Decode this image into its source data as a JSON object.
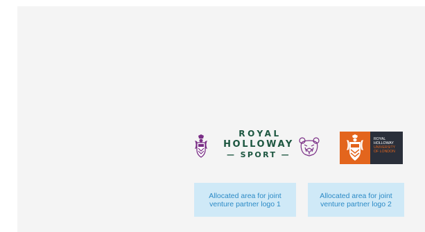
{
  "logos": {
    "sport": {
      "line1": "ROYAL",
      "line2": "HOLLOWAY",
      "line3": "— SPORT —",
      "color": "#1d5640",
      "accent": "#7a2e86",
      "icons": [
        "crest-icon",
        "bear-icon"
      ]
    },
    "university": {
      "line1": "ROYAL",
      "line2": "HOLLOWAY",
      "line3": "UNIVERSITY",
      "line4": "OF LONDON",
      "orange": "#e3651d",
      "dark": "#2a2f3a",
      "icons": [
        "crest-icon"
      ]
    }
  },
  "placeholders": [
    {
      "line1": "Allocated area for joint",
      "line2": "venture partner logo 1"
    },
    {
      "line1": "Allocated area for joint",
      "line2": "venture partner logo 2"
    }
  ]
}
